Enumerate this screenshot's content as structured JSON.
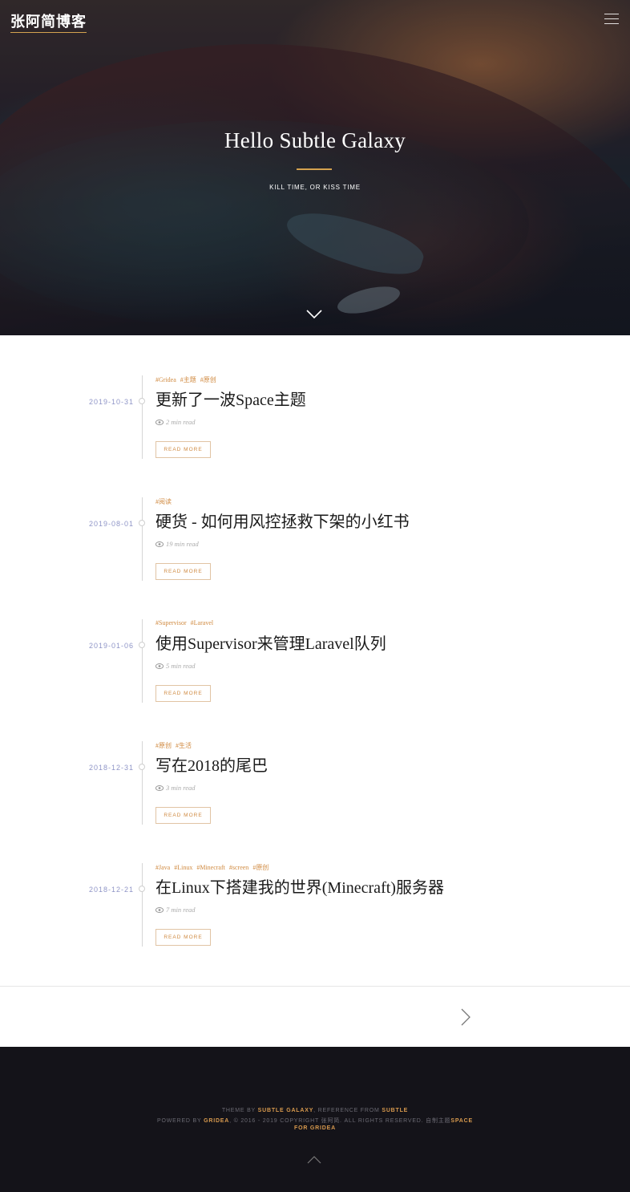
{
  "header": {
    "logo": "张阿简博客",
    "menu_icon": "hamburger-menu-icon"
  },
  "hero": {
    "title": "Hello Subtle Galaxy",
    "subtitle": "KILL TIME, OR KISS TIME",
    "accent_color": "#d4a24f",
    "scroll_icon": "chevron-down-icon"
  },
  "posts": [
    {
      "date": "2019-10-31",
      "tags": [
        "#Gridea",
        "#主题",
        "#原创"
      ],
      "title": "更新了一波Space主题",
      "read_time": "2 min read",
      "read_more": "READ MORE"
    },
    {
      "date": "2019-08-01",
      "tags": [
        "#阅读"
      ],
      "title": "硬货 - 如何用风控拯救下架的小红书",
      "read_time": "19 min read",
      "read_more": "READ MORE"
    },
    {
      "date": "2019-01-06",
      "tags": [
        "#Supervisor",
        "#Laravel"
      ],
      "title": "使用Supervisor来管理Laravel队列",
      "read_time": "5 min read",
      "read_more": "READ MORE"
    },
    {
      "date": "2018-12-31",
      "tags": [
        "#原创",
        "#生活"
      ],
      "title": "写在2018的尾巴",
      "read_time": "3 min read",
      "read_more": "READ MORE"
    },
    {
      "date": "2018-12-21",
      "tags": [
        "#Java",
        "#Linux",
        "#Minecraft",
        "#screen",
        "#原创"
      ],
      "title": "在Linux下搭建我的世界(Minecraft)服务器",
      "read_time": "7 min read",
      "read_more": "READ MORE"
    }
  ],
  "pager": {
    "next_icon": "chevron-right-icon"
  },
  "footer": {
    "theme_by": "THEME BY",
    "theme_name": "SUBTLE GALAXY",
    "reference_from": ", REFERENCE FROM",
    "reference_name": "SUBTLE",
    "powered_by": "POWERED BY",
    "powered_name": "GRIDEA",
    "copyright": ", © 2016 - 2019 COPYRIGHT 张阿简. ALL RIGHTS RESERVED. 自制主题",
    "space_link_1": "SPACE",
    "space_link_2": "FOR GRIDEA",
    "back_to_top_icon": "chevron-up-icon",
    "highlight_color": "#d89a4e"
  }
}
